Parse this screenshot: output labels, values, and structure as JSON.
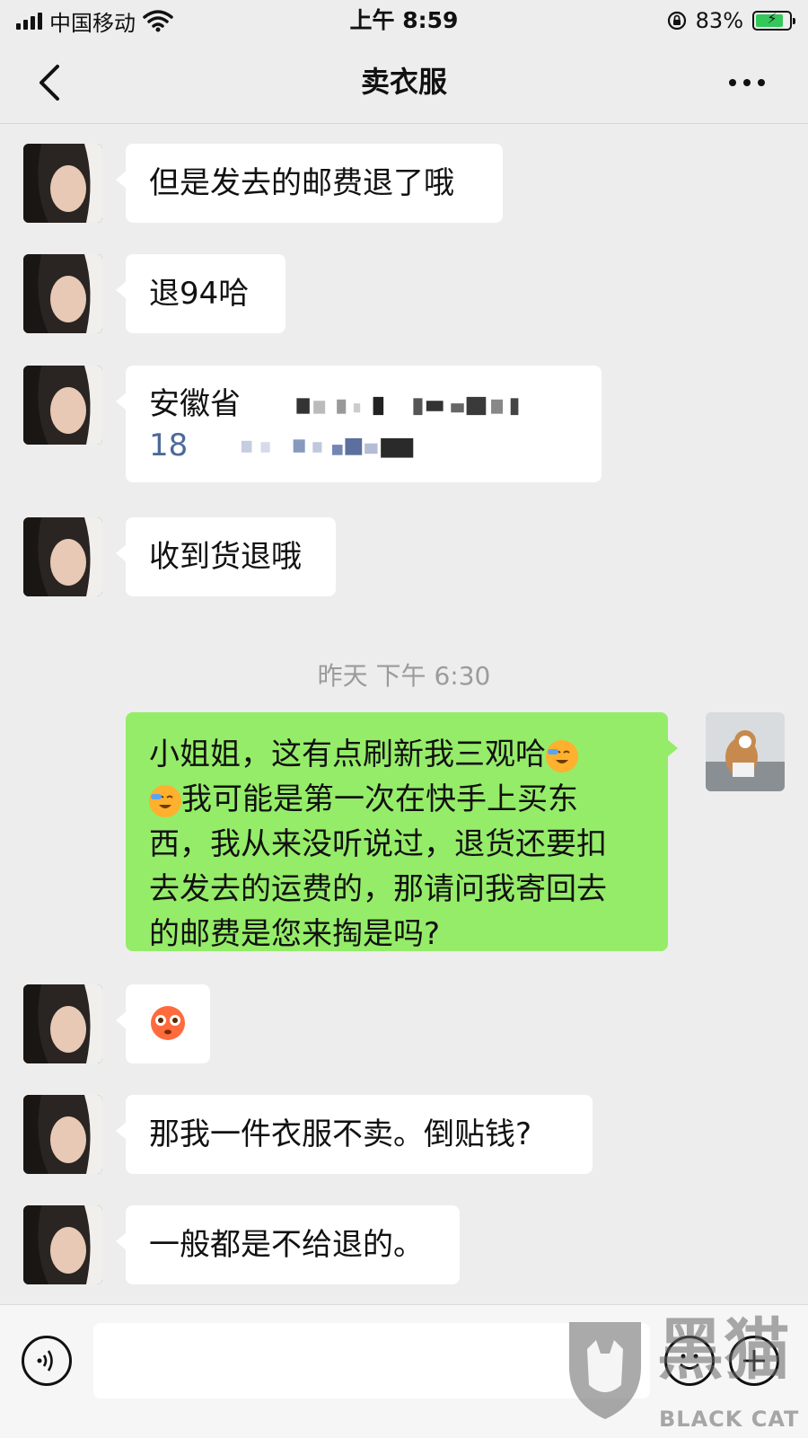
{
  "status_bar": {
    "carrier": "中国移动",
    "time": "上午 8:59",
    "battery_percent": "83%",
    "battery_level": 0.83
  },
  "nav": {
    "title": "卖衣服"
  },
  "messages": [
    {
      "side": "in",
      "text": "但是发去的邮费退了哦"
    },
    {
      "side": "in",
      "text": "退94哈"
    },
    {
      "side": "in",
      "text_line1": "安徽省",
      "text_line2": "18"
    },
    {
      "side": "in",
      "text": "收到货退哦"
    },
    {
      "side": "out",
      "line1": "小姐姐，这有点刷新我三观哈",
      "line2": "我可能是第一次在快手上买东",
      "line3": "西，我从来没听说过，退货还要扣",
      "line4": "去发去的运费的，那请问我寄回去",
      "line5": "的邮费是您来掏是吗?"
    },
    {
      "side": "in",
      "emoji": "flushed-face"
    },
    {
      "side": "in",
      "text": "那我一件衣服不卖。倒贴钱?"
    },
    {
      "side": "in",
      "text": "一般都是不给退的。"
    }
  ],
  "timestamp": "昨天 下午 6:30",
  "input_bar": {
    "placeholder": ""
  },
  "watermark": {
    "big": "黑猫",
    "small": "BLACK CAT"
  },
  "colors": {
    "background": "#ededed",
    "incoming_bubble": "#ffffff",
    "outgoing_bubble": "#95ec69",
    "battery_fill": "#34c759"
  }
}
